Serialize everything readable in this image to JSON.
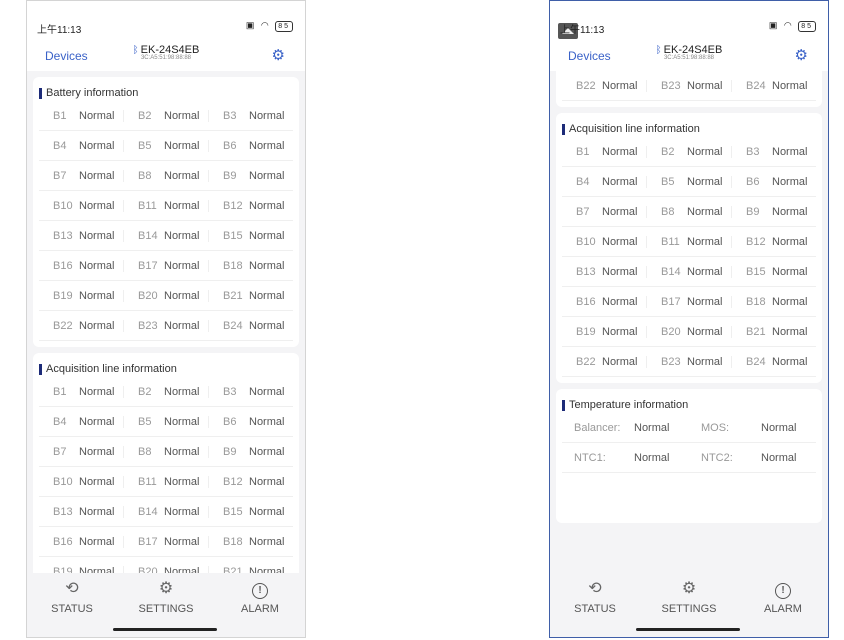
{
  "status_bar": {
    "time": "上午11:13",
    "battery": "85"
  },
  "nav": {
    "devices": "Devices",
    "device_name": "EK-24S4EB",
    "device_mac": "3C:A5:51:98:88:88"
  },
  "sections": {
    "battery_title": "Battery information",
    "acquisition_title": "Acquisition line information",
    "temperature_title": "Temperature information"
  },
  "cells": [
    {
      "id": "B1",
      "status": "Normal"
    },
    {
      "id": "B2",
      "status": "Normal"
    },
    {
      "id": "B3",
      "status": "Normal"
    },
    {
      "id": "B4",
      "status": "Normal"
    },
    {
      "id": "B5",
      "status": "Normal"
    },
    {
      "id": "B6",
      "status": "Normal"
    },
    {
      "id": "B7",
      "status": "Normal"
    },
    {
      "id": "B8",
      "status": "Normal"
    },
    {
      "id": "B9",
      "status": "Normal"
    },
    {
      "id": "B10",
      "status": "Normal"
    },
    {
      "id": "B11",
      "status": "Normal"
    },
    {
      "id": "B12",
      "status": "Normal"
    },
    {
      "id": "B13",
      "status": "Normal"
    },
    {
      "id": "B14",
      "status": "Normal"
    },
    {
      "id": "B15",
      "status": "Normal"
    },
    {
      "id": "B16",
      "status": "Normal"
    },
    {
      "id": "B17",
      "status": "Normal"
    },
    {
      "id": "B18",
      "status": "Normal"
    },
    {
      "id": "B19",
      "status": "Normal"
    },
    {
      "id": "B20",
      "status": "Normal"
    },
    {
      "id": "B21",
      "status": "Normal"
    },
    {
      "id": "B22",
      "status": "Normal"
    },
    {
      "id": "B23",
      "status": "Normal"
    },
    {
      "id": "B24",
      "status": "Normal"
    }
  ],
  "temperature": [
    {
      "label": "Balancer:",
      "value": "Normal"
    },
    {
      "label": "MOS:",
      "value": "Normal"
    },
    {
      "label": "NTC1:",
      "value": "Normal"
    },
    {
      "label": "NTC2:",
      "value": "Normal"
    }
  ],
  "tabs": [
    {
      "label": "STATUS"
    },
    {
      "label": "SETTINGS"
    },
    {
      "label": "ALARM"
    }
  ],
  "colors": {
    "accent": "#3a62c8",
    "section_marker": "#1d2b78"
  }
}
